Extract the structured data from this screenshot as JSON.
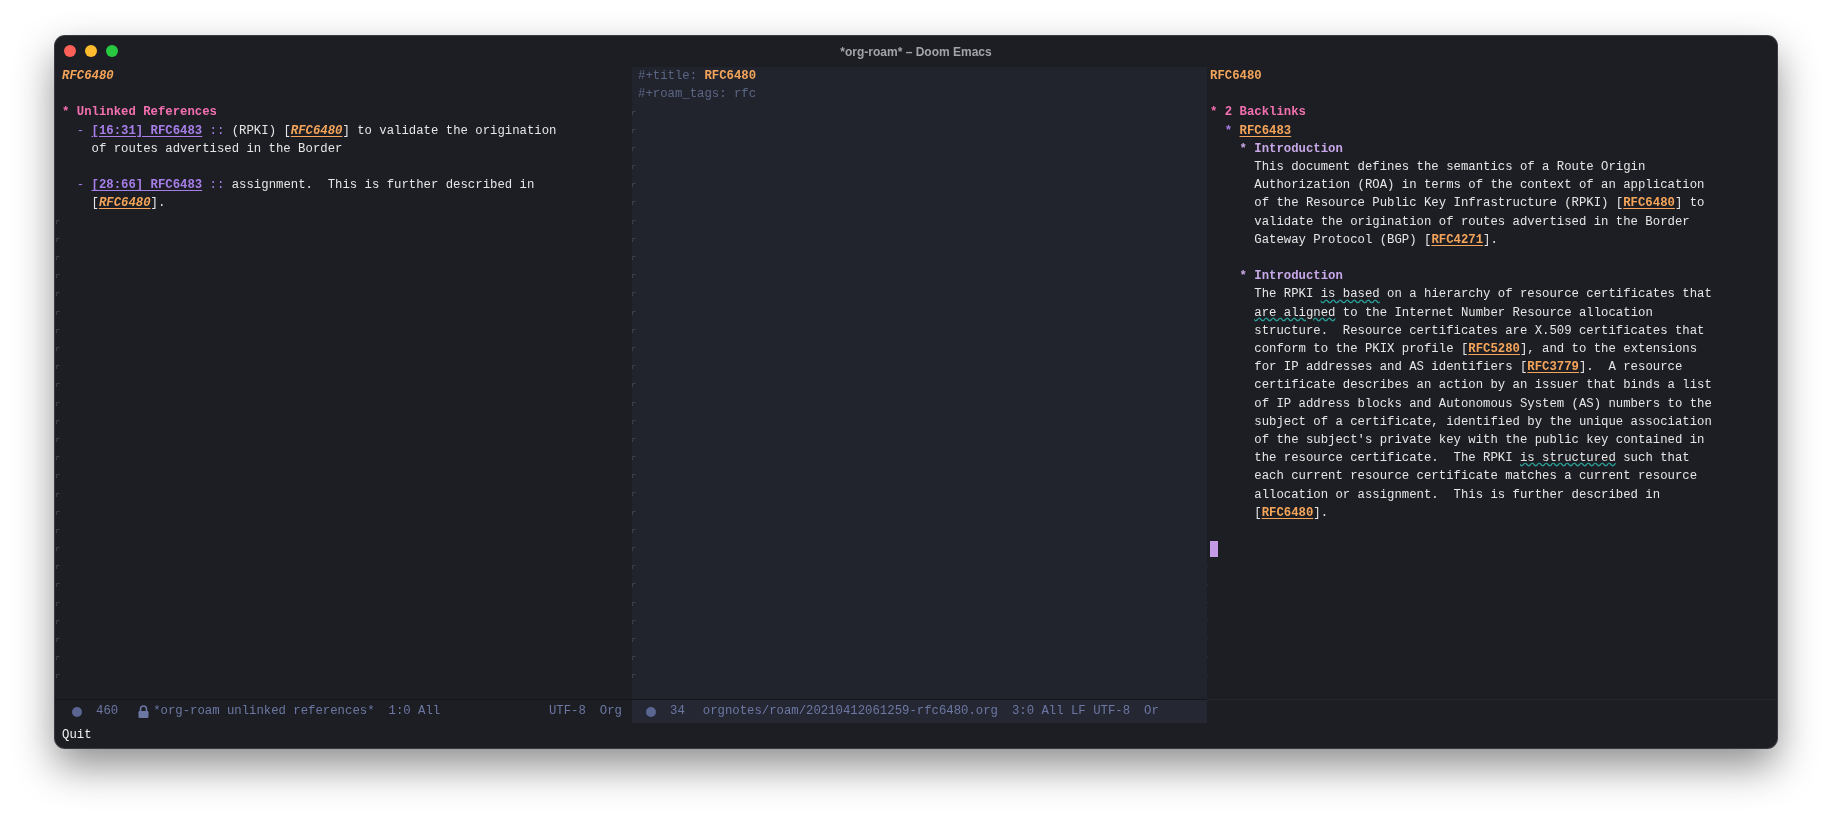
{
  "window": {
    "title": "*org-roam* – Doom Emacs"
  },
  "left_pane": {
    "title": "RFC6480",
    "heading": {
      "star": "*",
      "text": "Unlinked References"
    },
    "items": [
      {
        "bullet": "-",
        "lines": [
          [
            {
              "kind": "link",
              "text": "[16:31] RFC6483"
            },
            {
              "kind": "sep",
              "text": " :: "
            },
            {
              "kind": "text",
              "text": "(RPKI) ["
            },
            {
              "kind": "ref",
              "text": "RFC6480"
            },
            {
              "kind": "text",
              "text": "] to validate the origination"
            }
          ],
          [
            {
              "kind": "text",
              "text": "of routes advertised in the Border"
            }
          ]
        ]
      },
      {
        "bullet": "-",
        "lines": [
          [
            {
              "kind": "link",
              "text": "[28:66] RFC6483"
            },
            {
              "kind": "sep",
              "text": " :: "
            },
            {
              "kind": "text",
              "text": "assignment.  This is further described in"
            }
          ],
          [
            {
              "kind": "text",
              "text": "["
            },
            {
              "kind": "ref",
              "text": "RFC6480"
            },
            {
              "kind": "text",
              "text": "]."
            }
          ]
        ]
      }
    ],
    "mode_line": {
      "line_count": "460",
      "buffer": "*org-roam unlinked references*",
      "position": "1:0 All",
      "encoding": "UTF-8",
      "mode": "Org"
    }
  },
  "middle_pane": {
    "lines": [
      [
        {
          "kind": "meta",
          "text": "#+title: "
        },
        {
          "kind": "title",
          "text": "RFC6480"
        }
      ],
      [
        {
          "kind": "meta",
          "text": "#+roam_tags: rfc"
        }
      ]
    ],
    "mode_line": {
      "line_count": "34",
      "file": "orgnotes/roam/20210412061259-rfc6480.org",
      "position": "3:0 All LF UTF-8",
      "mode": "Or"
    }
  },
  "right_pane": {
    "title": "RFC6480",
    "heading": {
      "star": "*",
      "text": "2 Backlinks"
    },
    "source": {
      "star": "*",
      "link": "RFC6483"
    },
    "sections": [
      {
        "star": "*",
        "title": "Introduction",
        "lines": [
          [
            {
              "kind": "text",
              "text": "This document defines the semantics of a Route Origin"
            }
          ],
          [
            {
              "kind": "text",
              "text": "Authorization (ROA) in terms of the context of an application"
            }
          ],
          [
            {
              "kind": "text",
              "text": "of the Resource Public Key Infrastructure (RPKI) ["
            },
            {
              "kind": "ref",
              "text": "RFC6480"
            },
            {
              "kind": "text",
              "text": "] to"
            }
          ],
          [
            {
              "kind": "text",
              "text": "validate the origination of routes advertised in the Border"
            }
          ],
          [
            {
              "kind": "text",
              "text": "Gateway Protocol (BGP) ["
            },
            {
              "kind": "ref",
              "text": "RFC4271"
            },
            {
              "kind": "text",
              "text": "]."
            }
          ]
        ]
      },
      {
        "star": "*",
        "title": "Introduction",
        "lines": [
          [
            {
              "kind": "text",
              "text": "The RPKI "
            },
            {
              "kind": "spell",
              "text": "is based"
            },
            {
              "kind": "text",
              "text": " on a hierarchy of resource certificates that"
            }
          ],
          [
            {
              "kind": "spell",
              "text": "are aligned"
            },
            {
              "kind": "text",
              "text": " to the Internet Number Resource allocation"
            }
          ],
          [
            {
              "kind": "text",
              "text": "structure.  Resource certificates are X.509 certificates that"
            }
          ],
          [
            {
              "kind": "text",
              "text": "conform to the PKIX profile ["
            },
            {
              "kind": "ref",
              "text": "RFC5280"
            },
            {
              "kind": "text",
              "text": "], and to the extensions"
            }
          ],
          [
            {
              "kind": "text",
              "text": "for IP addresses and AS identifiers ["
            },
            {
              "kind": "ref",
              "text": "RFC3779"
            },
            {
              "kind": "text",
              "text": "].  A resource"
            }
          ],
          [
            {
              "kind": "text",
              "text": "certificate describes an action by an issuer that binds a list"
            }
          ],
          [
            {
              "kind": "text",
              "text": "of IP address blocks and Autonomous System (AS) numbers to the"
            }
          ],
          [
            {
              "kind": "text",
              "text": "subject of a certificate, identified by the unique association"
            }
          ],
          [
            {
              "kind": "text",
              "text": "of the subject's private key with the public key contained in"
            }
          ],
          [
            {
              "kind": "text",
              "text": "the resource certificate.  The RPKI "
            },
            {
              "kind": "spell",
              "text": "is structured"
            },
            {
              "kind": "text",
              "text": " such that"
            }
          ],
          [
            {
              "kind": "text",
              "text": "each current resource certificate matches a current resource"
            }
          ],
          [
            {
              "kind": "text",
              "text": "allocation or assignment.  This is further described in"
            }
          ],
          [
            {
              "kind": "text",
              "text": "["
            },
            {
              "kind": "ref",
              "text": "RFC6480"
            },
            {
              "kind": "text",
              "text": "]."
            }
          ]
        ]
      }
    ]
  },
  "echo_area": "Quit"
}
